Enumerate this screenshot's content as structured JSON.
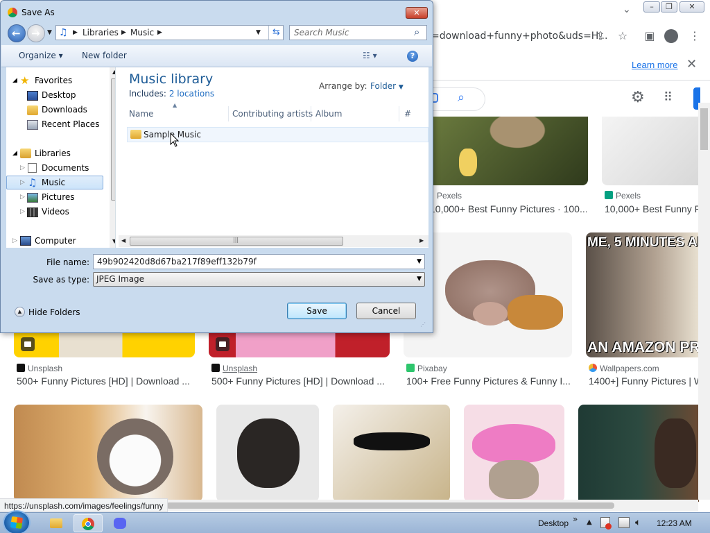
{
  "browser": {
    "address_text": "=download+funny+photo&uds=H...",
    "learn_more": "Learn more",
    "status_url": "https://unsplash.com/images/feelings/funny",
    "results": [
      {
        "source": "Pexels",
        "title": "10,000+ Best Funny Pictures · 100..."
      },
      {
        "source": "Pexels",
        "title": "10,000+ Best Funny P"
      },
      {
        "source": "Unsplash",
        "title": "500+ Funny Pictures [HD] | Download ..."
      },
      {
        "source": "Unsplash",
        "title": "500+ Funny Pictures [HD] | Download ..."
      },
      {
        "source": "Pixabay",
        "title": "100+ Free Funny Pictures & Funny I..."
      },
      {
        "source": "Wallpapers.com",
        "title": "1400+] Funny Pictures | W"
      }
    ],
    "meme_top": "ME, 5 MINUTES AFT",
    "meme_bottom": "AN AMAZON PRI"
  },
  "dialog": {
    "title": "Save As",
    "path": [
      "Libraries",
      "Music"
    ],
    "search_placeholder": "Search Music",
    "organize": "Organize ▾",
    "new_folder": "New folder",
    "nav": {
      "favorites": "Favorites",
      "desktop": "Desktop",
      "downloads": "Downloads",
      "recent": "Recent Places",
      "libraries": "Libraries",
      "documents": "Documents",
      "music": "Music",
      "pictures": "Pictures",
      "videos": "Videos",
      "computer": "Computer"
    },
    "library_title": "Music library",
    "includes_label": "Includes:",
    "includes_link": "2 locations",
    "arrange_label": "Arrange by:",
    "arrange_value": "Folder",
    "columns": [
      "Name",
      "Contributing artists",
      "Album",
      "#"
    ],
    "files": [
      {
        "name": "Sample Music"
      }
    ],
    "file_name_label": "File name:",
    "file_name_value": "49b902420d8d67ba217f89eff132b79f",
    "save_type_label": "Save as type:",
    "save_type_value": "JPEG Image",
    "hide_folders": "Hide Folders",
    "save": "Save",
    "cancel": "Cancel"
  },
  "taskbar": {
    "desktop": "Desktop",
    "time": "12:23 AM"
  },
  "colors": {
    "google_blue": "#1a73e8",
    "dialog_frame": "#c9dbee",
    "library_title": "#1e5c97"
  }
}
